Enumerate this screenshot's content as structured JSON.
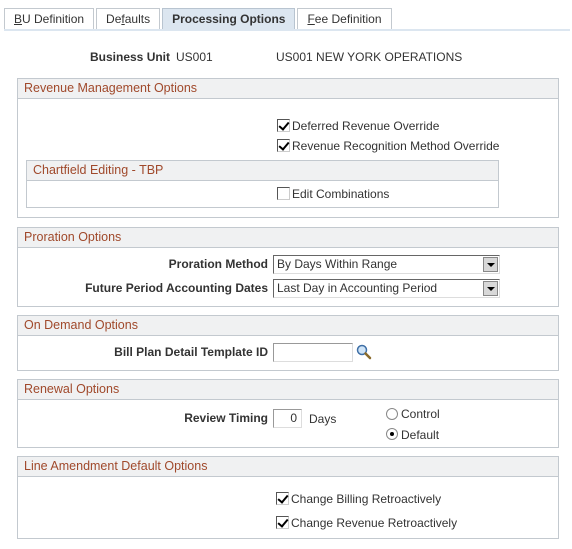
{
  "tabs": [
    {
      "label": "BU Definition",
      "accesskey": "B",
      "rest": "U Definition",
      "pre": "",
      "active": false
    },
    {
      "label": "Defaults",
      "accesskey": "f",
      "pre": "De",
      "rest": "aults",
      "active": false
    },
    {
      "label": "Processing Options",
      "active": true
    },
    {
      "label": "Fee Definition",
      "accesskey": "F",
      "pre": "",
      "rest": "ee Definition",
      "active": false
    }
  ],
  "business_unit": {
    "label": "Business Unit",
    "value": "US001",
    "description": "US001 NEW YORK OPERATIONS"
  },
  "revenue_management": {
    "title": "Revenue Management Options",
    "deferred_revenue_override": {
      "label": "Deferred Revenue Override",
      "checked": true
    },
    "revenue_recognition_override": {
      "label": "Revenue Recognition Method Override",
      "checked": true
    },
    "chartfield": {
      "title": "Chartfield Editing - TBP",
      "edit_combinations": {
        "label": "Edit Combinations",
        "checked": false
      }
    }
  },
  "proration": {
    "title": "Proration Options",
    "method": {
      "label": "Proration Method",
      "value": "By Days Within Range"
    },
    "future_dates": {
      "label": "Future Period Accounting Dates",
      "value": "Last Day in Accounting Period"
    }
  },
  "on_demand": {
    "title": "On Demand Options",
    "template_id": {
      "label": "Bill Plan Detail Template ID",
      "value": ""
    }
  },
  "renewal": {
    "title": "Renewal Options",
    "review_timing": {
      "label": "Review Timing",
      "value": "0",
      "unit": "Days"
    },
    "options": [
      {
        "label": "Control",
        "selected": false
      },
      {
        "label": "Default",
        "selected": true
      }
    ]
  },
  "line_amendment": {
    "title": "Line Amendment Default Options",
    "change_billing": {
      "label": "Change Billing Retroactively",
      "checked": true
    },
    "change_revenue": {
      "label": "Change Revenue Retroactively",
      "checked": true
    }
  }
}
